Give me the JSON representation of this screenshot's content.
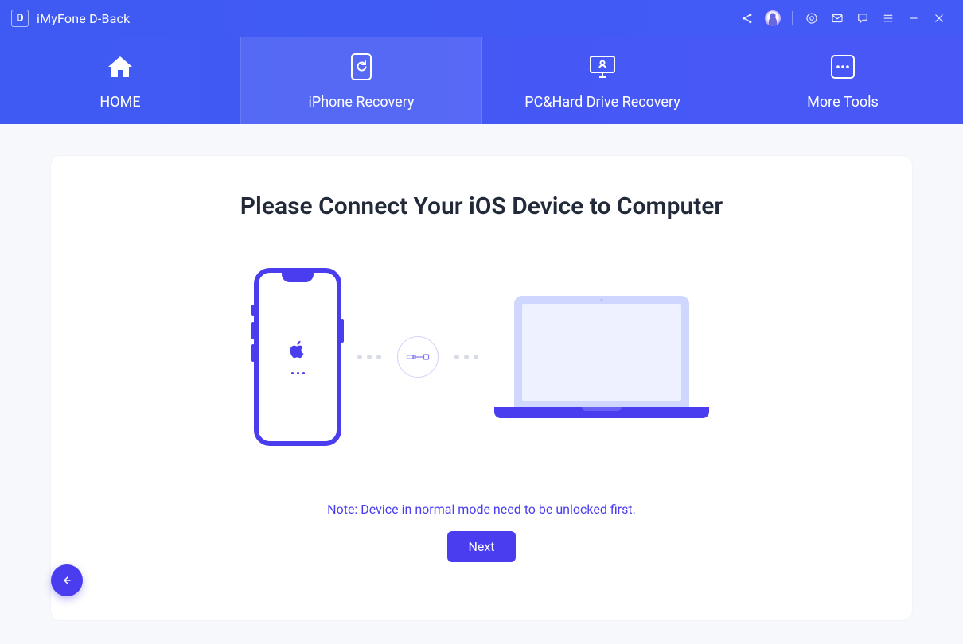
{
  "app": {
    "logo_letter": "D",
    "title": "iMyFone D-Back"
  },
  "nav": {
    "items": [
      {
        "label": "HOME"
      },
      {
        "label": "iPhone Recovery"
      },
      {
        "label": "PC&Hard Drive Recovery"
      },
      {
        "label": "More Tools"
      }
    ],
    "active_index": 1
  },
  "main": {
    "headline": "Please Connect Your iOS Device to Computer",
    "note": "Note: Device in normal mode need to be unlocked first.",
    "next_label": "Next"
  }
}
